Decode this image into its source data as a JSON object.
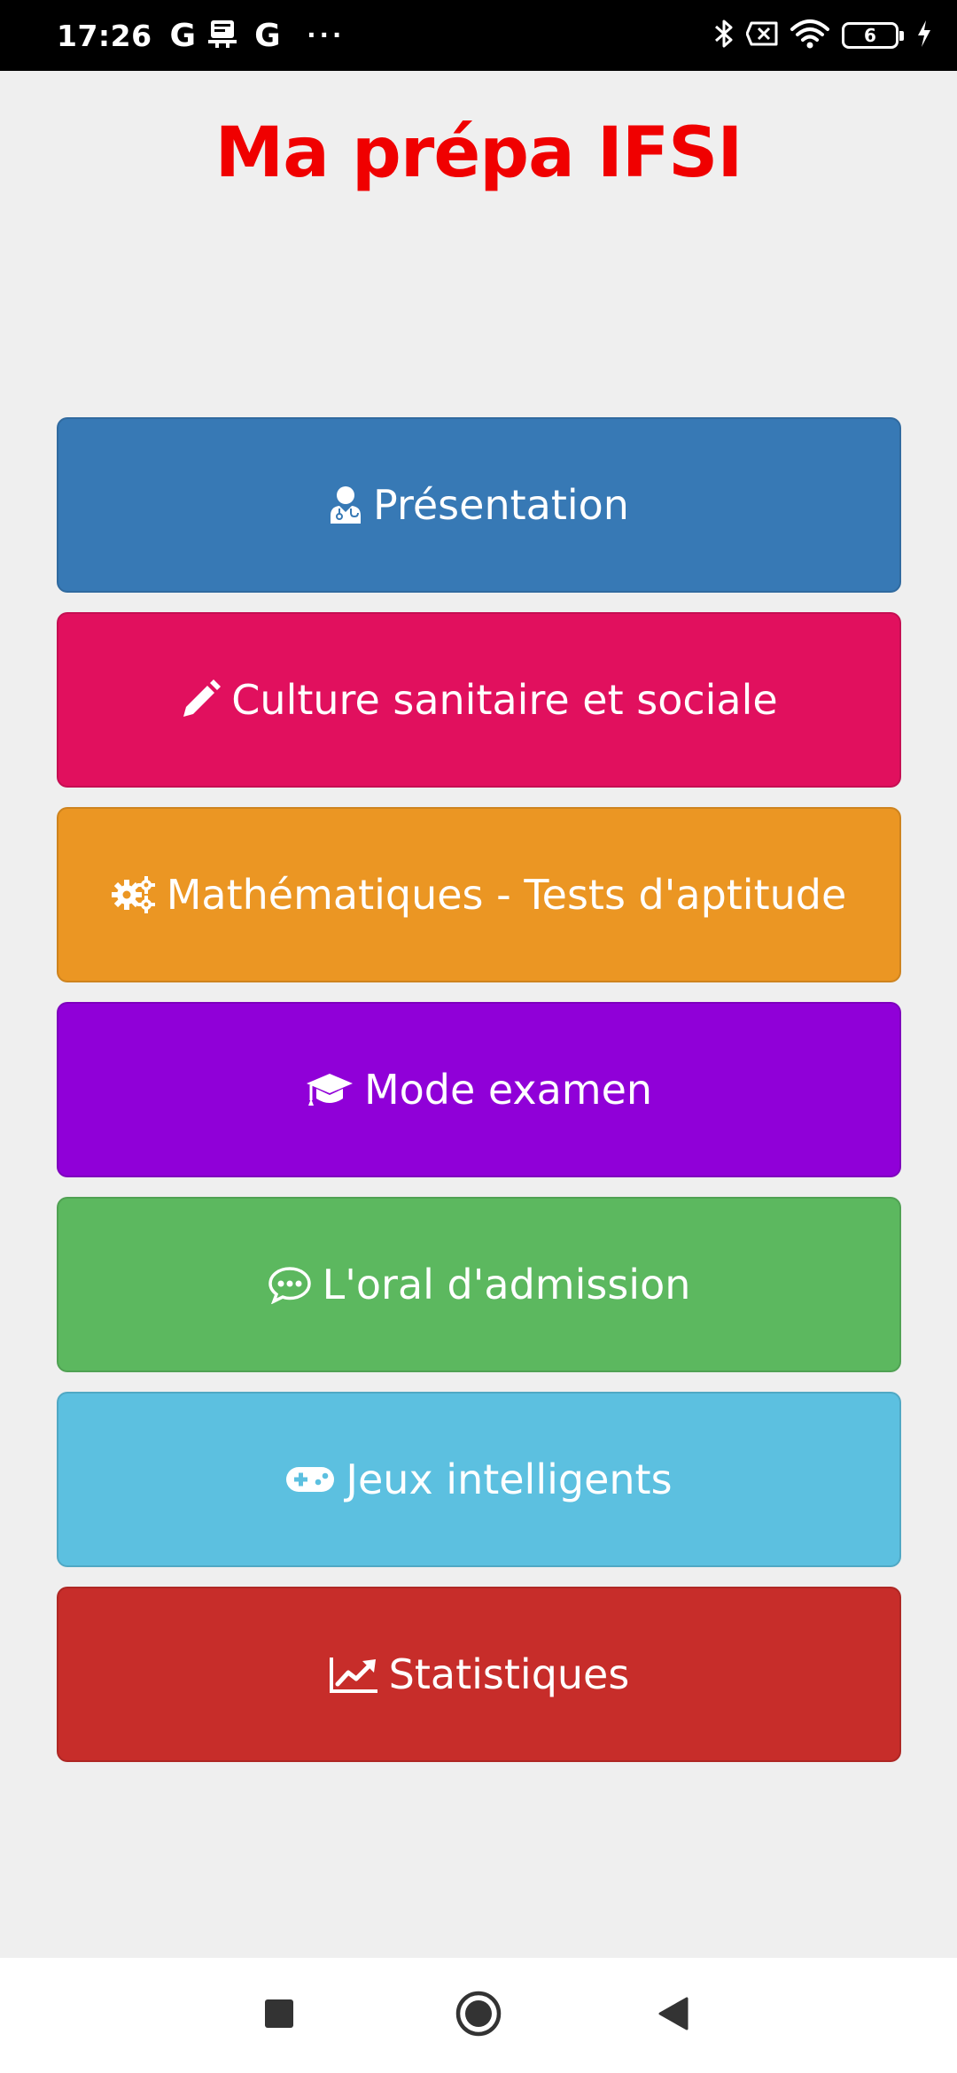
{
  "status_bar": {
    "time": "17:26",
    "left_icons": [
      "google-icon",
      "notification-icon",
      "google-icon"
    ],
    "more": "···",
    "right_icons": [
      "bluetooth-icon",
      "sim-off-icon",
      "wifi-icon",
      "battery-icon",
      "charging-icon"
    ],
    "battery_level": "6"
  },
  "app": {
    "title": "Ma prépa IFSI",
    "title_color": "#f00000"
  },
  "menu": {
    "items": [
      {
        "label": "Présentation",
        "icon": "doctor-icon",
        "color": "#3779b5"
      },
      {
        "label": "Culture sanitaire et sociale",
        "icon": "pencil-icon",
        "color": "#e1105e"
      },
      {
        "label": "Mathématiques - Tests d'aptitude",
        "icon": "gears-icon",
        "color": "#eb9623"
      },
      {
        "label": "Mode examen",
        "icon": "graduation-cap-icon",
        "color": "#9000d8"
      },
      {
        "label": "L'oral d'admission",
        "icon": "speech-bubble-icon",
        "color": "#5cb85f"
      },
      {
        "label": "Jeux intelligents",
        "icon": "gamepad-icon",
        "color": "#5cc0e0"
      },
      {
        "label": "Statistiques",
        "icon": "line-chart-icon",
        "color": "#c72d2a"
      }
    ]
  },
  "nav_bar": {
    "buttons": [
      "recent-apps-icon",
      "home-icon",
      "back-icon"
    ]
  }
}
